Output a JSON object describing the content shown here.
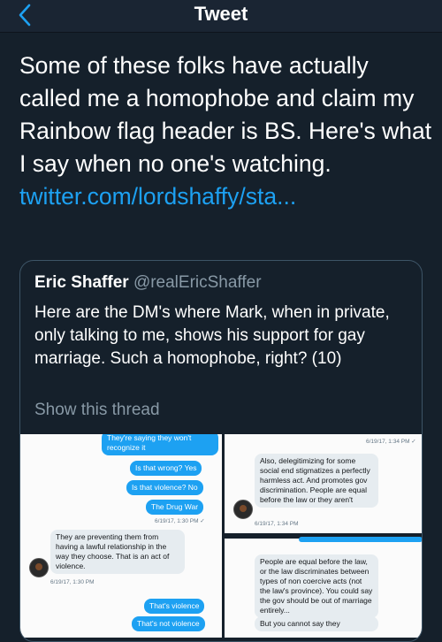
{
  "header": {
    "title": "Tweet",
    "back_icon": "chevron-left-icon"
  },
  "tweet": {
    "text": "Some of these folks have actually called me a homophobe and claim my Rainbow flag header is BS. Here's what I say when no one's watching.",
    "link": "twitter.com/lordshaffy/sta..."
  },
  "quote": {
    "name": "Eric Shaffer",
    "handle": "@realEricShaffer",
    "text": "Here are the DM's where Mark, when in private, only talking to me, shows his support for gay marriage. Such a homophobe, right? (10)",
    "show_thread": "Show this thread"
  },
  "dm_left": {
    "msg1": "They're saying they won't recognize it",
    "msg2": "Is that wrong? Yes",
    "msg3": "Is that violence? No",
    "msg4": "The Drug War",
    "ts1": "6/19/17, 1:30 PM ✓",
    "msg5": "They are preventing them from having a lawful relationship in the way they choose. That is an act of violence.",
    "ts2": "6/19/17, 1:30 PM",
    "msg6": "That's violence",
    "msg7": "That's not violence"
  },
  "dm_right": {
    "ts1": "6/19/17, 1:34 PM ✓",
    "msg1": "Also, delegitimizing for some social end stigmatizes a perfectly harmless act. And promotes gov discrimination. People are equal before the law or they aren't",
    "ts2": "6/19/17, 1:34 PM",
    "msg2": "People are equal before the law, or the law discriminates between types of non coercive acts (not the law's province). You could say the gov should be out of marriage entirely...",
    "msg3": "But you cannot say they"
  },
  "colors": {
    "background": "#15202b",
    "link": "#1da1f2",
    "muted": "#8899a6"
  }
}
